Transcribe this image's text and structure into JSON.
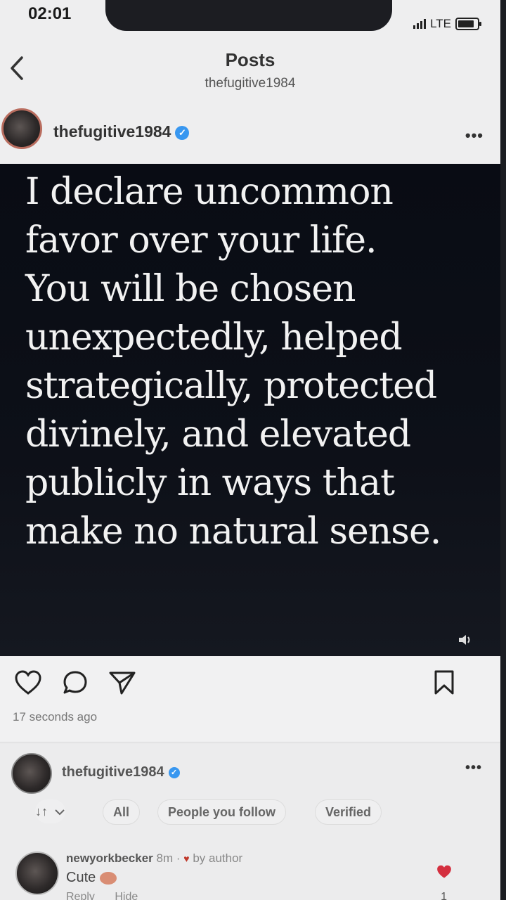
{
  "status_bar": {
    "time": "02:01",
    "network": "LTE"
  },
  "nav": {
    "title": "Posts",
    "subtitle": "thefugitive1984"
  },
  "post": {
    "username": "thefugitive1984",
    "quote_lines": [
      "I declare uncommon",
      "favor over your life.",
      "You will be chosen",
      "unexpectedly, helped",
      "strategically, protected",
      "divinely, and elevated",
      "publicly in ways that",
      "make no natural sense."
    ],
    "timestamp": "17 seconds ago"
  },
  "comments_section": {
    "header_username": "thefugitive1984",
    "sort_label": "↓↑",
    "filters": [
      "All",
      "People you follow",
      "Verified"
    ],
    "comment": {
      "author": "newyorkbecker",
      "age": "8m",
      "author_badge": "by author",
      "text": "Cute",
      "reply_label": "Reply",
      "hide_label": "Hide",
      "like_count": "1"
    }
  },
  "colors": {
    "verified": "#3897f0",
    "like": "#d42f3f",
    "quote_text": "#f2f2f2"
  },
  "icons": [
    "back-icon",
    "verified-icon",
    "more-icon",
    "sound-icon",
    "heart-icon",
    "comment-icon",
    "share-icon",
    "bookmark-icon",
    "chevron-down-icon"
  ]
}
